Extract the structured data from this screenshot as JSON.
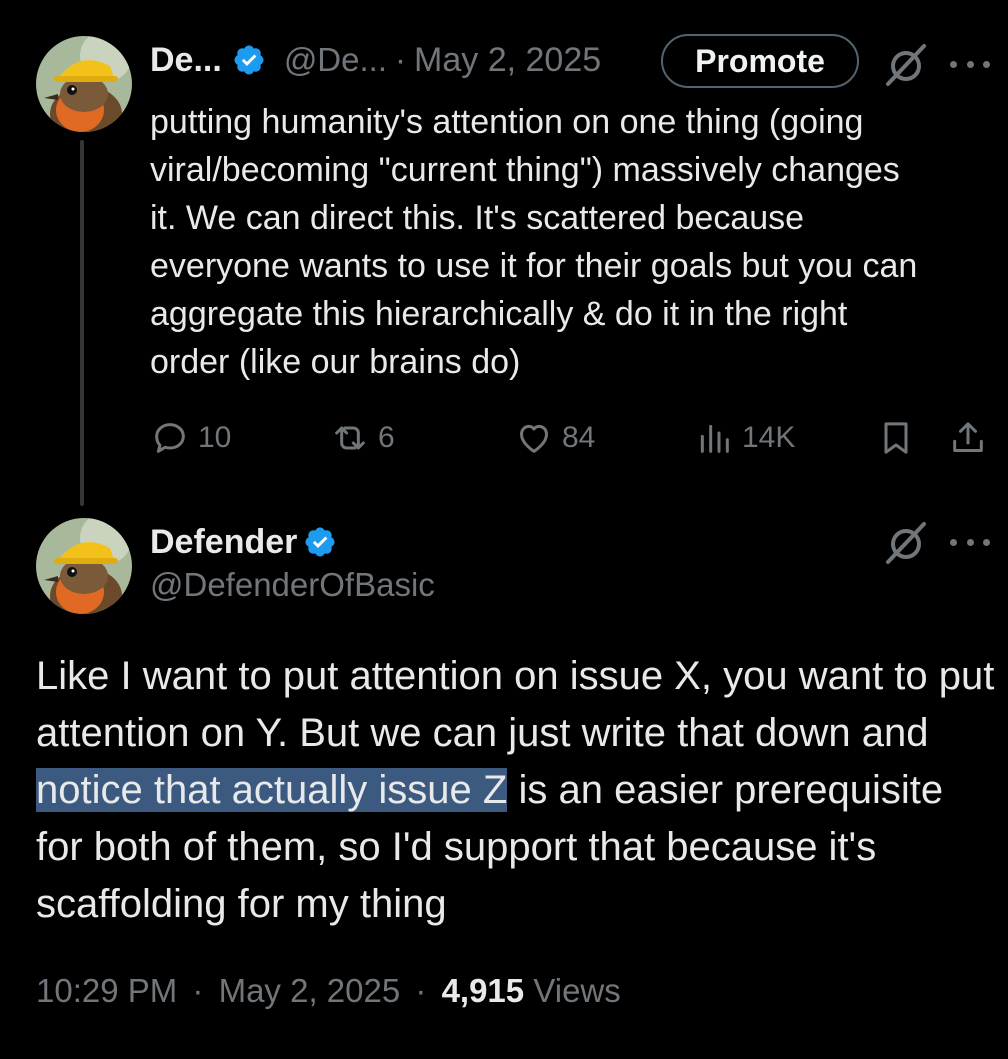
{
  "colors": {
    "background": "#000000",
    "text_primary": "#e7e9ea",
    "text_secondary": "#71767b",
    "verified_blue": "#1d9bf0",
    "highlight": "#3c5a80"
  },
  "tweet1": {
    "author_name": "De...",
    "handle": "@De...",
    "separator": "·",
    "date": "May 2, 2025",
    "promote_label": "Promote",
    "avatar_icon": "avatar-robin-hardhat",
    "verified_icon": "verified-badge-icon",
    "grok_icon": "grok-icon",
    "more_icon": "more-dots-icon",
    "body": "putting humanity's attention on one thing (going\nviral/becoming \"current thing\") massively changes\nit. We can direct this. It's scattered because\neveryone wants to use it for their goals but you can\naggregate this hierarchically & do it in the right\norder (like our brains do)",
    "stats": {
      "replies": "10",
      "reposts": "6",
      "likes": "84",
      "views": "14K"
    }
  },
  "tweet2": {
    "author_name": "Defender",
    "handle": "@DefenderOfBasic",
    "body_before": "Like I want to put attention on issue X, you want to put attention on Y. But we can just write that down and ",
    "body_highlight": "notice that actually issue Z",
    "body_after": " is an easier prerequisite for both of them, so I'd support that because it's scaffolding for my thing",
    "time": "10:29 PM",
    "separator": "·",
    "date": "May 2, 2025",
    "views_count": "4,915",
    "views_label": "Views"
  }
}
